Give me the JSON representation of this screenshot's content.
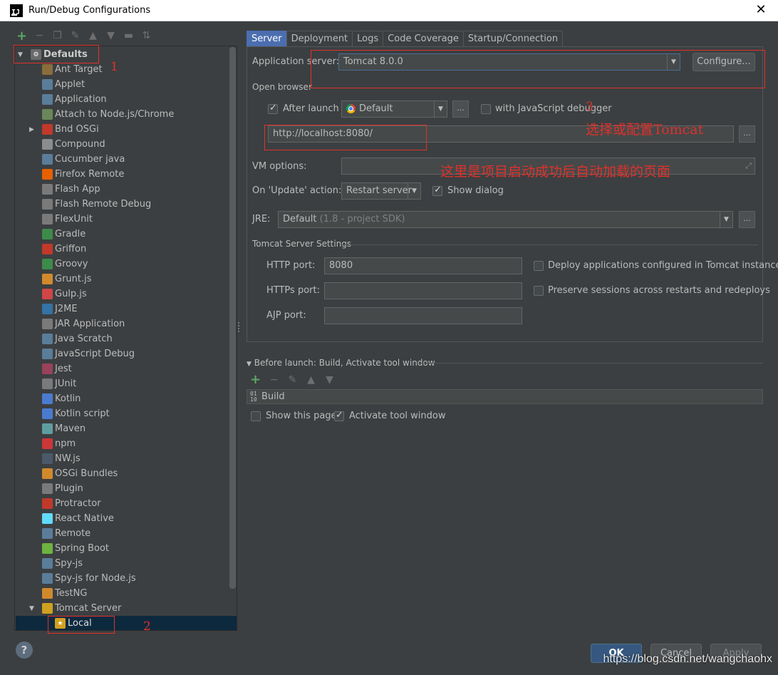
{
  "window": {
    "title": "Run/Debug Configurations"
  },
  "tree": {
    "root": "Defaults",
    "items": [
      {
        "label": "Ant Target",
        "icon": "ant-icon",
        "color": "#8a6d3b"
      },
      {
        "label": "Applet",
        "icon": "applet-icon",
        "color": "#5a7d9a"
      },
      {
        "label": "Application",
        "icon": "application-icon",
        "color": "#5a7d9a"
      },
      {
        "label": "Attach to Node.js/Chrome",
        "icon": "attach-icon",
        "color": "#6a8759"
      },
      {
        "label": "Bnd OSGi",
        "icon": "bnd-icon",
        "color": "#c0392b",
        "expandable": true
      },
      {
        "label": "Compound",
        "icon": "folder-icon",
        "color": "#8c8c8c"
      },
      {
        "label": "Cucumber java",
        "icon": "cucumber-icon",
        "color": "#5a7d9a"
      },
      {
        "label": "Firefox Remote",
        "icon": "firefox-icon",
        "color": "#e66000"
      },
      {
        "label": "Flash App",
        "icon": "flash-icon",
        "color": "#7a7a7a"
      },
      {
        "label": "Flash Remote Debug",
        "icon": "flash-icon",
        "color": "#7a7a7a"
      },
      {
        "label": "FlexUnit",
        "icon": "flexunit-icon",
        "color": "#7a7a7a"
      },
      {
        "label": "Gradle",
        "icon": "gradle-icon",
        "color": "#3d8b4a"
      },
      {
        "label": "Griffon",
        "icon": "griffon-icon",
        "color": "#c0392b"
      },
      {
        "label": "Groovy",
        "icon": "groovy-icon",
        "color": "#3d8b4a"
      },
      {
        "label": "Grunt.js",
        "icon": "grunt-icon",
        "color": "#d08a2c"
      },
      {
        "label": "Gulp.js",
        "icon": "gulp-icon",
        "color": "#cf4647"
      },
      {
        "label": "J2ME",
        "icon": "j2me-icon",
        "color": "#3572a5"
      },
      {
        "label": "JAR Application",
        "icon": "jar-icon",
        "color": "#7a7a7a"
      },
      {
        "label": "Java Scratch",
        "icon": "java-scratch-icon",
        "color": "#5a7d9a"
      },
      {
        "label": "JavaScript Debug",
        "icon": "js-debug-icon",
        "color": "#5a7d9a"
      },
      {
        "label": "Jest",
        "icon": "jest-icon",
        "color": "#99425b"
      },
      {
        "label": "JUnit",
        "icon": "junit-icon",
        "color": "#7a7a7a"
      },
      {
        "label": "Kotlin",
        "icon": "kotlin-icon",
        "color": "#4a7bd0"
      },
      {
        "label": "Kotlin script",
        "icon": "kotlin-icon",
        "color": "#4a7bd0"
      },
      {
        "label": "Maven",
        "icon": "maven-icon",
        "color": "#5f9ea0"
      },
      {
        "label": "npm",
        "icon": "npm-icon",
        "color": "#cb3837"
      },
      {
        "label": "NW.js",
        "icon": "nwjs-icon",
        "color": "#4a5a6a"
      },
      {
        "label": "OSGi Bundles",
        "icon": "osgi-icon",
        "color": "#d08a2c"
      },
      {
        "label": "Plugin",
        "icon": "plugin-icon",
        "color": "#7a7a7a"
      },
      {
        "label": "Protractor",
        "icon": "protractor-icon",
        "color": "#c0392b"
      },
      {
        "label": "React Native",
        "icon": "react-icon",
        "color": "#61dafb"
      },
      {
        "label": "Remote",
        "icon": "remote-icon",
        "color": "#5a7d9a"
      },
      {
        "label": "Spring Boot",
        "icon": "spring-icon",
        "color": "#6db33f"
      },
      {
        "label": "Spy-js",
        "icon": "spyjs-icon",
        "color": "#5a7d9a"
      },
      {
        "label": "Spy-js for Node.js",
        "icon": "spyjs-icon",
        "color": "#5a7d9a"
      },
      {
        "label": "TestNG",
        "icon": "testng-icon",
        "color": "#d08a2c"
      },
      {
        "label": "Tomcat Server",
        "icon": "tomcat-icon",
        "color": "#d0a020",
        "expanded": true
      }
    ],
    "selected": "Local"
  },
  "annotations": {
    "n1": "1",
    "n2": "2",
    "n3": "3",
    "tomcat_note": "选择或配置Tomcat",
    "url_note": "这里是项目启动成功后自动加载的页面"
  },
  "tabs": [
    "Server",
    "Deployment",
    "Logs",
    "Code Coverage",
    "Startup/Connection"
  ],
  "server": {
    "app_server_label": "Application server:",
    "app_server_value": "Tomcat 8.0.0",
    "configure_label": "Configure...",
    "open_browser_label": "Open browser",
    "after_launch_label": "After launch",
    "browser_value": "Default",
    "js_debugger_label": "with JavaScript debugger",
    "url_value": "http://localhost:8080/",
    "vm_options_label": "VM options:",
    "on_update_label": "On 'Update' action:",
    "on_update_value": "Restart server",
    "show_dialog_label": "Show dialog",
    "jre_label": "JRE:",
    "jre_value": "Default",
    "jre_hint": "(1.8 - project SDK)",
    "tomcat_settings_label": "Tomcat Server Settings",
    "http_port_label": "HTTP port:",
    "http_port_value": "8080",
    "https_port_label": "HTTPs port:",
    "ajp_port_label": "AJP port:",
    "deploy_label": "Deploy applications configured in Tomcat instance",
    "preserve_label": "Preserve sessions across restarts and redeploys"
  },
  "before_launch": {
    "header": "Before launch: Build, Activate tool window",
    "item": "Build",
    "show_page_label": "Show this page",
    "activate_label": "Activate tool window"
  },
  "buttons": {
    "ok": "OK",
    "cancel": "Cancel",
    "apply": "Apply",
    "help": "?"
  },
  "watermark": "https://blog.csdn.net/wangchaohx",
  "colors": {
    "accent": "#4b6eaf",
    "annotation": "#e0312b",
    "selection": "#0d293e"
  }
}
